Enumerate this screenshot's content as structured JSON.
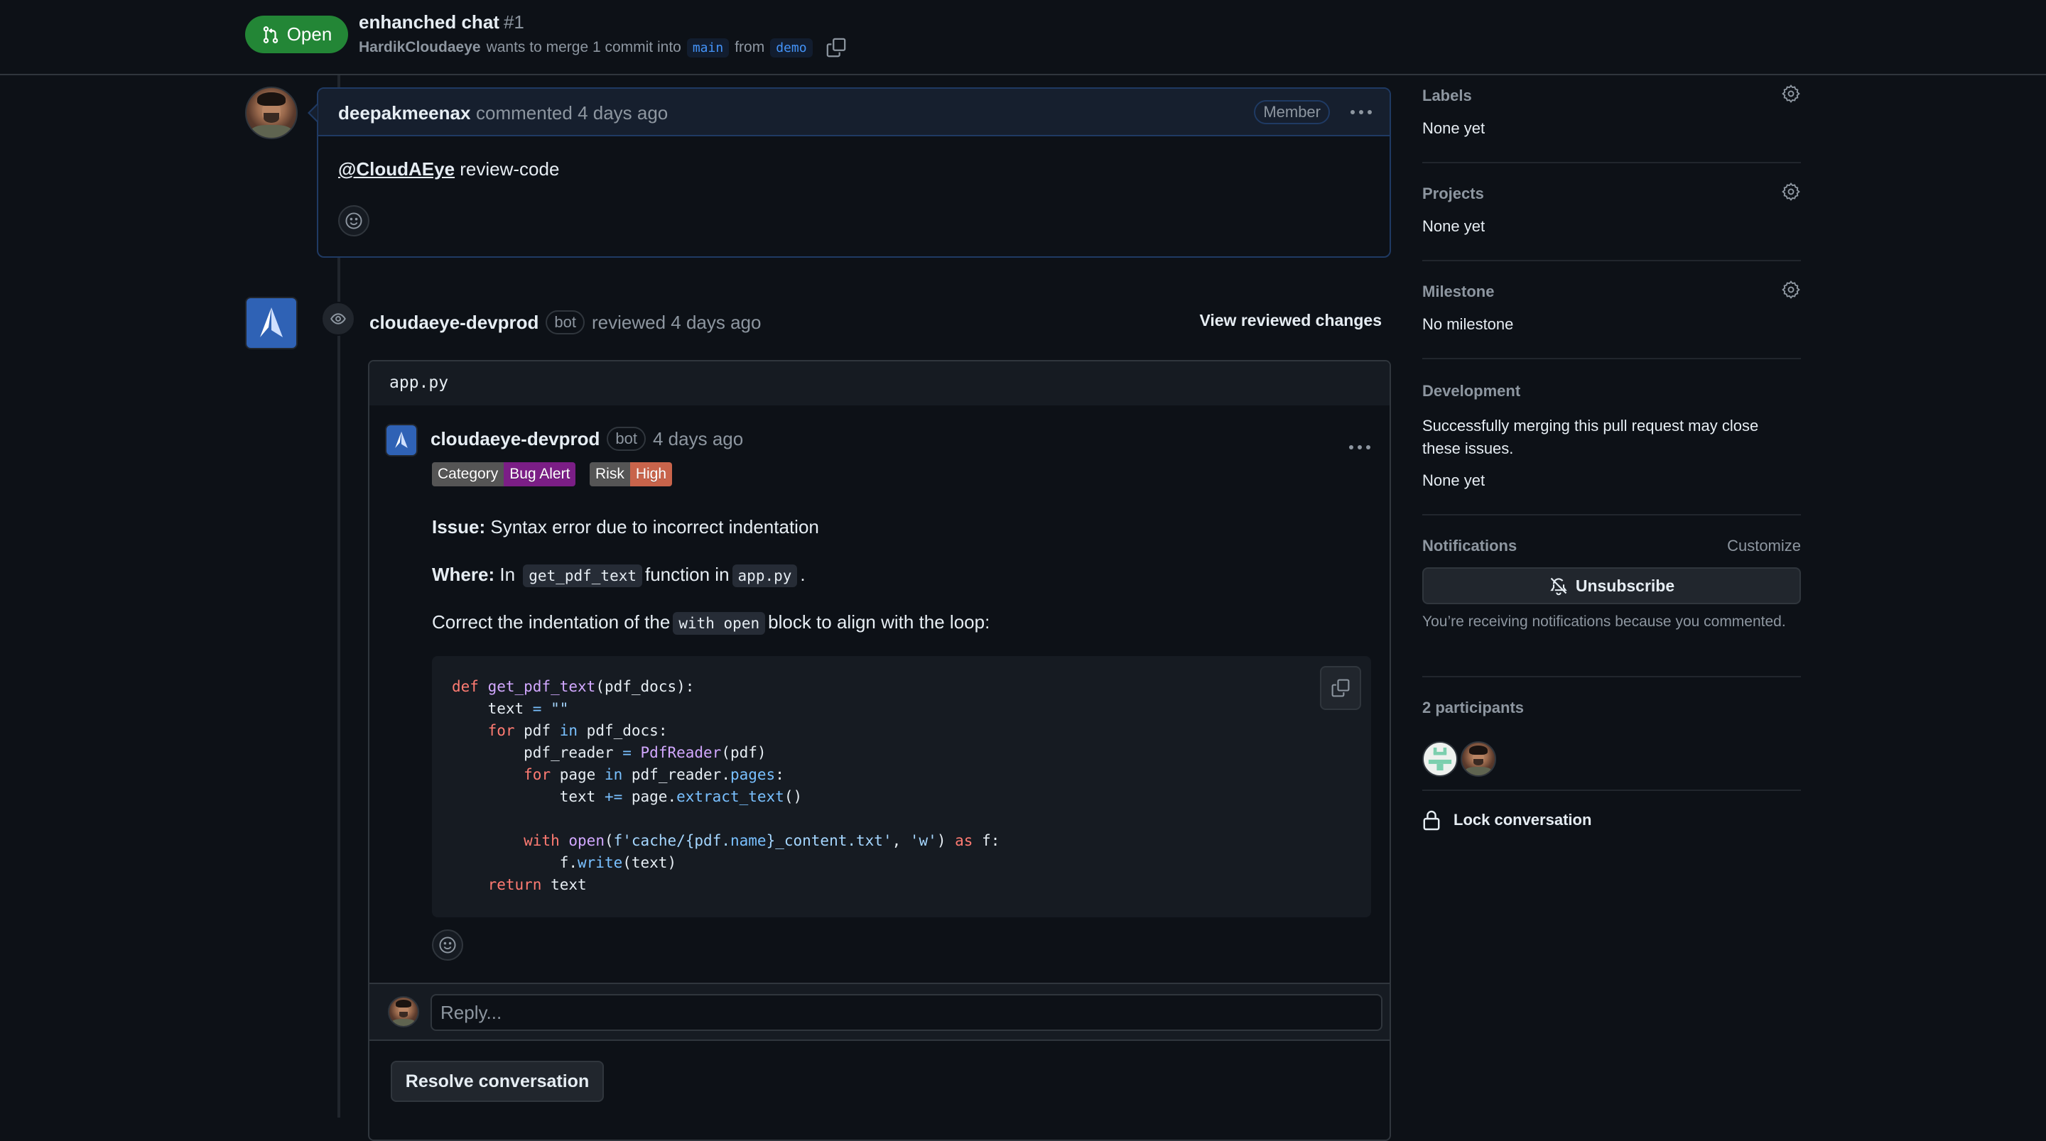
{
  "header": {
    "state_label": "Open",
    "state_icon": "git-pull-request-icon",
    "state_color": "#238636",
    "title": "enhanched chat",
    "number": "#1",
    "author": "HardikCloudaeye",
    "merge_text": "wants to merge 1 commit into",
    "base_branch": "main",
    "from_text": "from",
    "head_branch": "demo",
    "copy_icon": "copy-icon"
  },
  "comment": {
    "author": "deepakmeenax",
    "meta": "commented 4 days ago",
    "role_badge": "Member",
    "mention": "@CloudAEye",
    "body": " review-code",
    "kebab_icon": "kebab-horizontal-icon",
    "emoji_icon": "smiley-icon"
  },
  "review": {
    "author": "cloudaeye-devprod",
    "bot_badge": "bot",
    "meta": "reviewed 4 days ago",
    "view_changes": "View reviewed changes",
    "event_icon": "eye-icon",
    "file": "app.py",
    "inline_comment": {
      "author": "cloudaeye-devprod",
      "bot_badge": "bot",
      "meta": "4 days ago",
      "shields": [
        {
          "key": "Category",
          "value": "Bug Alert",
          "value_color": "#7b1e86"
        },
        {
          "key": "Risk",
          "value": "High",
          "value_color": "#c8644b"
        }
      ],
      "issue_label": "Issue:",
      "issue_text": " Syntax error due to incorrect indentation",
      "where_label": "Where:",
      "where_pre": " In",
      "where_code_1": "get_pdf_text",
      "where_mid": "function in",
      "where_code_2": "app.py",
      "where_post": ".",
      "correct_pre": "Correct the indentation of the",
      "correct_code": "with open",
      "correct_post": "block to align with the loop:",
      "code_lines": [
        "def get_pdf_text(pdf_docs):",
        "    text = \"\"",
        "    for pdf in pdf_docs:",
        "        pdf_reader = PdfReader(pdf)",
        "        for page in pdf_reader.pages:",
        "            text += page.extract_text()",
        "",
        "        with open(f'cache/{pdf.name}_content.txt', 'w') as f:",
        "            f.write(text)",
        "    return text"
      ],
      "code_copy_icon": "copy-icon"
    },
    "reply_placeholder": "Reply...",
    "resolve_label": "Resolve conversation"
  },
  "sidebar": {
    "labels": {
      "title": "Labels",
      "value": "None yet"
    },
    "projects": {
      "title": "Projects",
      "value": "None yet"
    },
    "milestone": {
      "title": "Milestone",
      "value": "No milestone"
    },
    "development": {
      "title": "Development",
      "description": "Successfully merging this pull request may close these issues.",
      "value": "None yet"
    },
    "notifications": {
      "title": "Notifications",
      "customize": "Customize",
      "unsubscribe": "Unsubscribe",
      "note": "You’re receiving notifications because you commented."
    },
    "participants": {
      "title": "2 participants",
      "count": 2
    },
    "lock": "Lock conversation"
  }
}
